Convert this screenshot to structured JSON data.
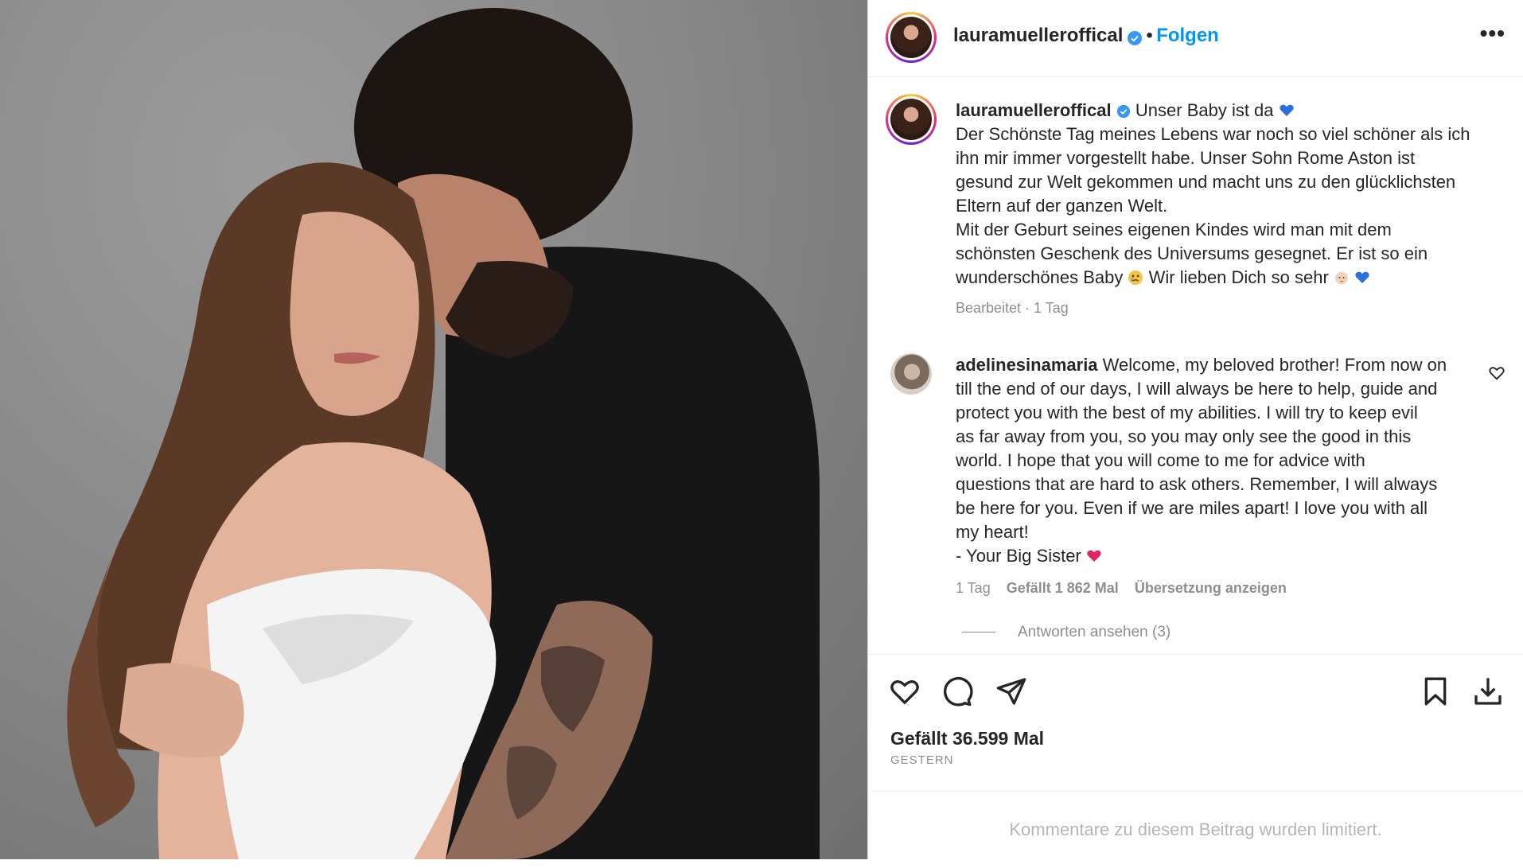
{
  "post": {
    "author": "lauramuelleroffical",
    "follow_label": "Folgen",
    "separator": "•",
    "more_label": "•••"
  },
  "caption": {
    "author": "lauramuelleroffical",
    "headline": "Unser Baby ist da",
    "lines": [
      "Der Schönste Tag meines Lebens war noch so viel schöner als ich",
      "ihn mir immer vorgestellt habe. Unser Sohn Rome Aston ist",
      "gesund zur Welt gekommen und macht uns zu den glücklichsten",
      "Eltern auf der ganzen Welt.",
      "Mit der Geburt seines eigenen Kindes wird man mit dem",
      "schönsten Geschenk des Universums gesegnet. Er ist so ein"
    ],
    "last_line_a": "wunderschönes Baby",
    "last_line_b": " Wir lieben Dich so sehr",
    "meta": "Bearbeitet · 1 Tag"
  },
  "comment": {
    "author": "adelinesinamaria",
    "first_line": " Welcome, my beloved brother! From now on",
    "lines": [
      "till the end of our days, I will always be here to help, guide and",
      "protect you with the best of my abilities. I will try to keep evil",
      "as far away from you, so you may only see the good in this",
      "world. I hope that you will come to me for advice with",
      "questions that are hard to ask others. Remember, I will always",
      "be here for you. Even if we are miles apart! I love you with all",
      "my heart!"
    ],
    "signature": "- Your Big Sister",
    "time": "1 Tag",
    "likes": "Gefällt 1 862 Mal",
    "translate": "Übersetzung anzeigen",
    "replies": "Antworten ansehen (3)"
  },
  "footer": {
    "likes": "Gefällt 36.599 Mal",
    "date": "GESTERN",
    "limited": "Kommentare zu diesem Beitrag wurden limitiert."
  },
  "colors": {
    "follow": "#0095f6",
    "verified": "#3897f0",
    "heart_blue": "#2a6fdb",
    "heart_red": "#e0245e"
  },
  "icons": [
    "verified-badge-icon",
    "blue-heart-emoji",
    "crying-face-emoji",
    "baby-emoji",
    "red-heart-emoji",
    "like-heart-icon",
    "comment-icon",
    "share-icon",
    "bookmark-icon",
    "download-icon",
    "small-heart-icon"
  ]
}
